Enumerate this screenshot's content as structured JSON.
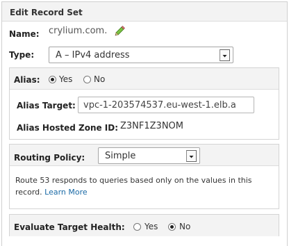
{
  "header": {
    "title": "Edit Record Set"
  },
  "name": {
    "label": "Name:",
    "value": "crylium.com."
  },
  "type": {
    "label": "Type:",
    "selected": "A – IPv4 address"
  },
  "alias": {
    "label": "Alias:",
    "options": [
      "Yes",
      "No"
    ],
    "selected": "Yes",
    "target_label": "Alias Target:",
    "target_value": "vpc-1-203574537.eu-west-1.elb.a",
    "zone_label": "Alias Hosted Zone ID:",
    "zone_value": "Z3NF1Z3NOM"
  },
  "routing": {
    "label": "Routing Policy:",
    "selected": "Simple",
    "description": "Route 53 responds to queries based only on the values in this record.",
    "learn_more": "Learn More"
  },
  "health": {
    "label": "Evaluate Target Health:",
    "options": [
      "Yes",
      "No"
    ],
    "selected": "No"
  },
  "colors": {
    "header_bg": "#f3f3f3",
    "link": "#1a6aa6"
  },
  "icons": {
    "edit": "pencil-icon",
    "dropdown": "dropdown-arrow-icon"
  }
}
